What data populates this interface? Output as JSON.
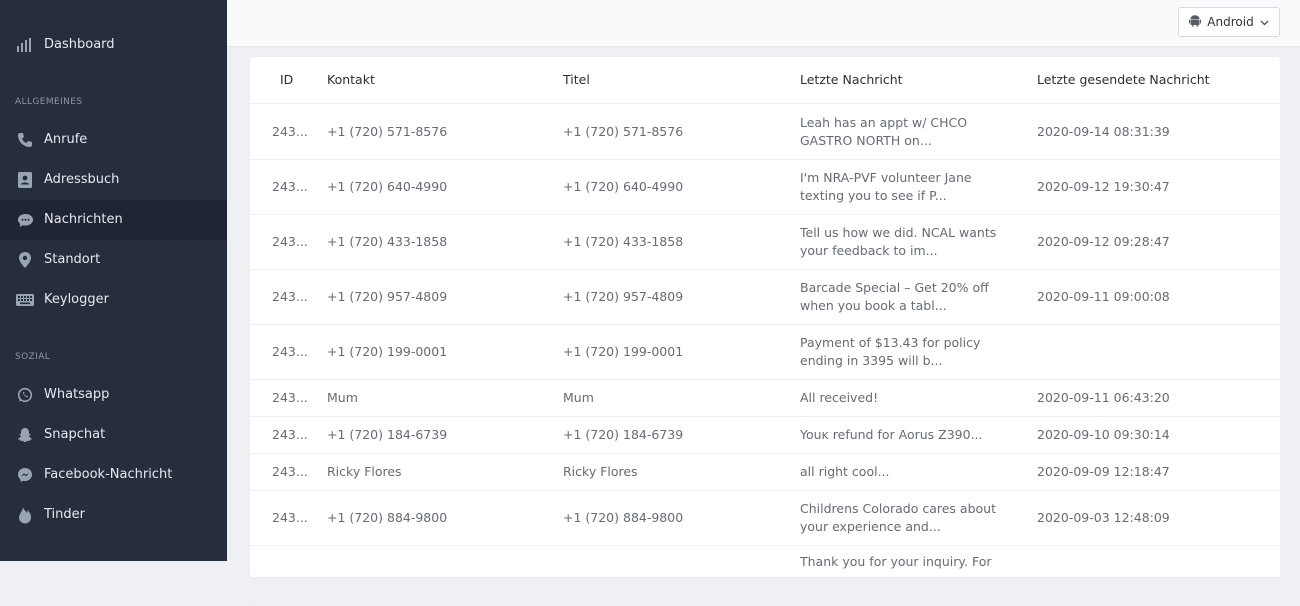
{
  "sidebar": {
    "dashboard": "Dashboard",
    "section_general": "ALLGEMEINES",
    "general_items": [
      {
        "label": "Anrufe",
        "icon": "phone-icon"
      },
      {
        "label": "Adressbuch",
        "icon": "address-book-icon"
      },
      {
        "label": "Nachrichten",
        "icon": "message-icon",
        "active": true
      },
      {
        "label": "Standort",
        "icon": "location-pin-icon"
      },
      {
        "label": "Keylogger",
        "icon": "keyboard-icon"
      }
    ],
    "section_social": "SOZIAL",
    "social_items": [
      {
        "label": "Whatsapp",
        "icon": "whatsapp-icon"
      },
      {
        "label": "Snapchat",
        "icon": "snapchat-icon"
      },
      {
        "label": "Facebook-Nachricht",
        "icon": "messenger-icon"
      },
      {
        "label": "Tinder",
        "icon": "tinder-icon"
      }
    ]
  },
  "header": {
    "device_label": "Android"
  },
  "table": {
    "columns": [
      "ID",
      "Kontakt",
      "Titel",
      "Letzte Nachricht",
      "Letzte gesendete Nachricht"
    ],
    "rows": [
      {
        "id": "243...",
        "contact": "+1 (720) 571-8576",
        "title": "+1 (720) 571-8576",
        "msg1": "Leah has an appt w/ CHCO",
        "msg2": "GASTRO NORTH on...",
        "sent": "2020-09-14 08:31:39"
      },
      {
        "id": "243...",
        "contact": "+1 (720) 640-4990",
        "title": "+1 (720) 640-4990",
        "msg1": "I'm NRA-PVF volunteer Jane",
        "msg2": "texting you to see if P...",
        "sent": "2020-09-12 19:30:47"
      },
      {
        "id": "243...",
        "contact": "+1 (720) 433-1858",
        "title": "+1 (720) 433-1858",
        "msg1": "Tell us how we did. NCAL wants",
        "msg2": "your feedback to im...",
        "sent": "2020-09-12 09:28:47"
      },
      {
        "id": "243...",
        "contact": "+1 (720) 957-4809",
        "title": "+1 (720) 957-4809",
        "msg1": "Barcade Special – Get 20% off",
        "msg2": "when you book a tabl...",
        "sent": "2020-09-11 09:00:08"
      },
      {
        "id": "243...",
        "contact": "+1 (720) 199-0001",
        "title": "+1 (720) 199-0001",
        "msg1": "Payment of $13.43 for policy",
        "msg2": "ending in 3395 will b...",
        "sent": ""
      },
      {
        "id": "243...",
        "contact": "Mum",
        "title": "Mum",
        "msg1": "All received!",
        "msg2": "",
        "sent": "2020-09-11 06:43:20"
      },
      {
        "id": "243...",
        "contact": "+1 (720) 184-6739",
        "title": "+1 (720) 184-6739",
        "msg1": "Youĸ refund for Aorus Z390...",
        "msg2": "",
        "sent": "2020-09-10 09:30:14"
      },
      {
        "id": "243...",
        "contact": "Ricky Flores",
        "title": "Ricky Flores",
        "msg1": "all right cool...",
        "msg2": "",
        "sent": "2020-09-09 12:18:47"
      },
      {
        "id": "243...",
        "contact": "+1 (720) 884-9800",
        "title": "+1 (720) 884-9800",
        "msg1": "Childrens Colorado cares about",
        "msg2": "your experience and...",
        "sent": "2020-09-03 12:48:09"
      },
      {
        "id": "",
        "contact": "",
        "title": "",
        "msg1": "Thank you for your inquiry. For",
        "msg2": "",
        "sent": ""
      }
    ]
  },
  "colors": {
    "sidebar_bg": "#262d3d",
    "sidebar_active": "#1f2534",
    "icon_color": "#9aa3b2"
  }
}
